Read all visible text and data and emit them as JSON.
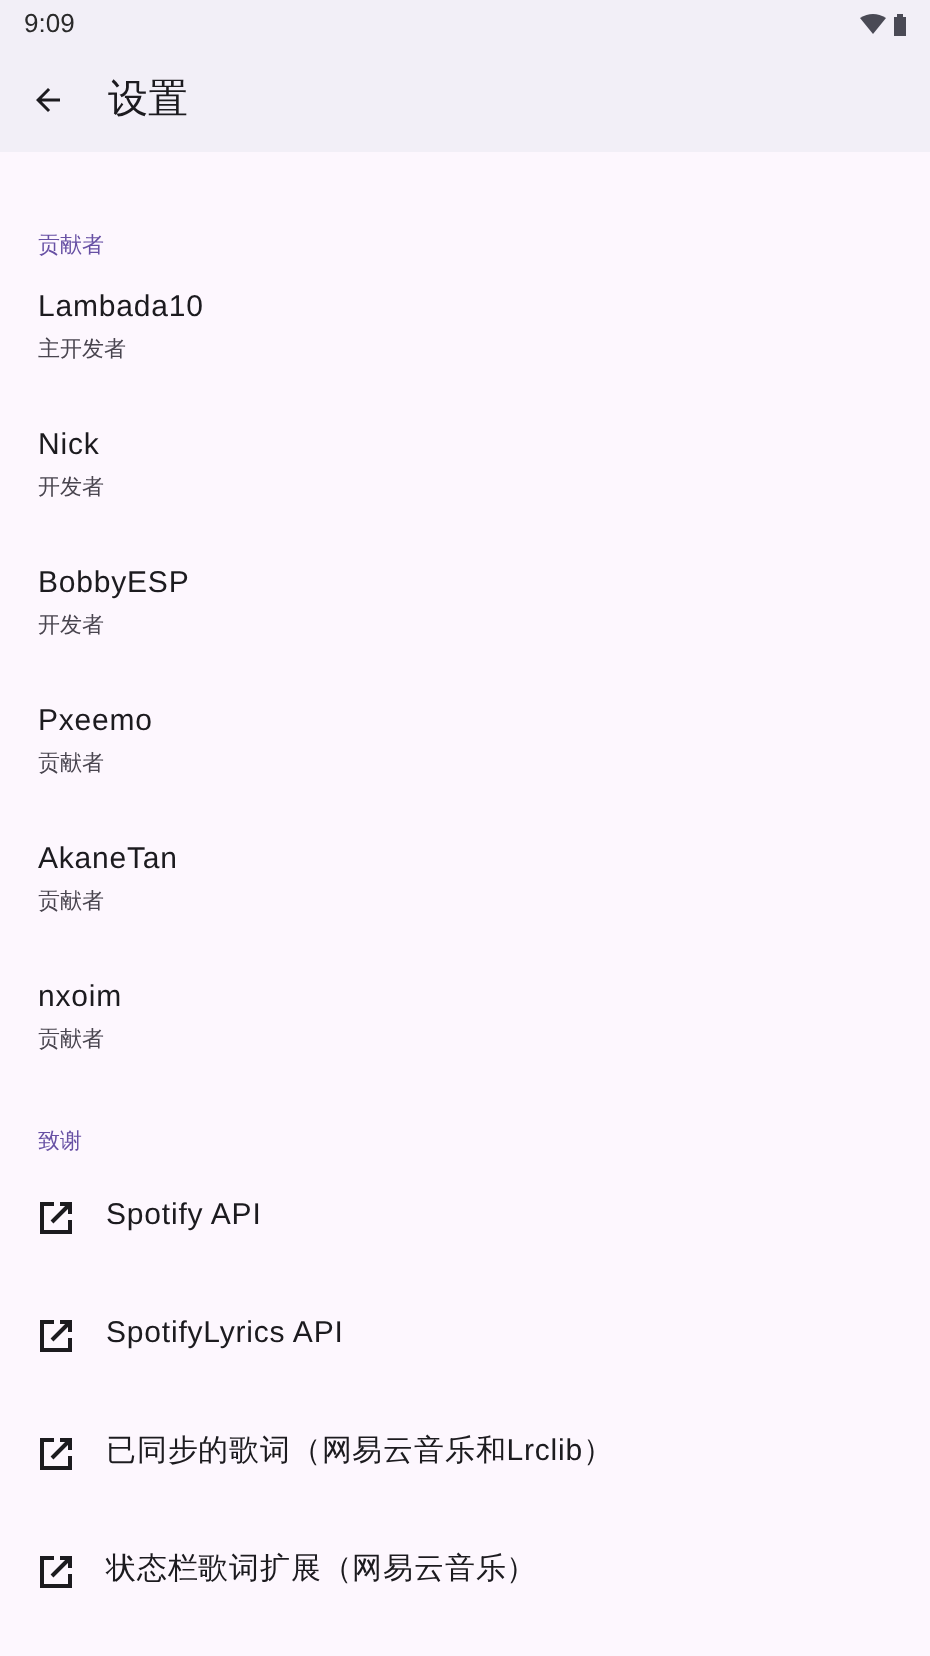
{
  "status_bar": {
    "time": "9:09"
  },
  "app_bar": {
    "title": "设置"
  },
  "sections": [
    {
      "kind": "people",
      "header": "贡献者",
      "items": [
        {
          "name": "Lambada10",
          "role": "主开发者"
        },
        {
          "name": "Nick",
          "role": "开发者"
        },
        {
          "name": "BobbyESP",
          "role": "开发者"
        },
        {
          "name": "Pxeemo",
          "role": "贡献者"
        },
        {
          "name": "AkaneTan",
          "role": "贡献者"
        },
        {
          "name": "nxoim",
          "role": "贡献者"
        }
      ]
    },
    {
      "kind": "links",
      "header": "致谢",
      "items": [
        {
          "label": "Spotify API"
        },
        {
          "label": "SpotifyLyrics API"
        },
        {
          "label": "已同步的歌词（网易云音乐和Lrclib）"
        },
        {
          "label": "状态栏歌词扩展（网易云音乐）"
        }
      ]
    }
  ]
}
